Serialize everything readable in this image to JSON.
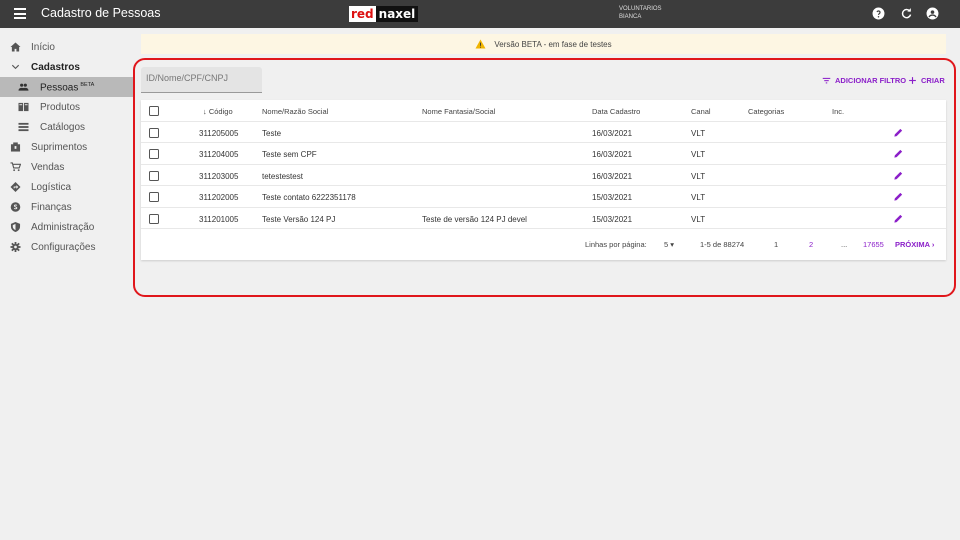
{
  "header": {
    "title": "Cadastro de Pessoas",
    "logo_red": "red",
    "logo_naxel": "naxel",
    "user_line1": "VOLUNTARIOS",
    "user_line2": "BIANCA",
    "icons": [
      "help-icon",
      "refresh-icon",
      "account-icon"
    ]
  },
  "sidebar": {
    "items": [
      {
        "label": "Início",
        "icon": "home-icon"
      },
      {
        "label": "Cadastros",
        "icon": "chevron-down-icon"
      },
      {
        "label": "Pessoas",
        "badge": "BETA",
        "icon": "people-icon"
      },
      {
        "label": "Produtos",
        "icon": "book-icon"
      },
      {
        "label": "Catálogos",
        "icon": "list-icon"
      },
      {
        "label": "Suprimentos",
        "icon": "box-icon"
      },
      {
        "label": "Vendas",
        "icon": "cart-icon"
      },
      {
        "label": "Logística",
        "icon": "direction-icon"
      },
      {
        "label": "Finanças",
        "icon": "money-icon"
      },
      {
        "label": "Administração",
        "icon": "shield-icon"
      },
      {
        "label": "Configurações",
        "icon": "gear-icon"
      }
    ]
  },
  "banner": {
    "text": "Versão BETA - em fase de testes"
  },
  "search": {
    "placeholder": "ID/Nome/CPF/CNPJ"
  },
  "toolbar": {
    "filter_label": "ADICIONAR FILTRO",
    "create_label": "CRIAR"
  },
  "table": {
    "columns": [
      "Código",
      "Nome/Razão Social",
      "Nome Fantasia/Social",
      "Data Cadastro",
      "Canal",
      "Categorias",
      "Inc."
    ],
    "sort_indicator": "↓",
    "rows": [
      {
        "codigo": "311205005",
        "nome": "Teste",
        "fantasia": "",
        "data": "16/03/2021",
        "canal": "VLT"
      },
      {
        "codigo": "311204005",
        "nome": "Teste sem CPF",
        "fantasia": "",
        "data": "16/03/2021",
        "canal": "VLT"
      },
      {
        "codigo": "311203005",
        "nome": "tetestestest",
        "fantasia": "",
        "data": "16/03/2021",
        "canal": "VLT"
      },
      {
        "codigo": "311202005",
        "nome": "Teste contato 6222351178",
        "fantasia": "",
        "data": "15/03/2021",
        "canal": "VLT"
      },
      {
        "codigo": "311201005",
        "nome": "Teste Versão 124 PJ",
        "fantasia": "Teste de versão 124 PJ devel",
        "data": "15/03/2021",
        "canal": "VLT"
      }
    ]
  },
  "pagination": {
    "rows_per_page_label": "Linhas por página:",
    "rows_per_page": "5",
    "range": "1-5 de 88274",
    "page_current": "1",
    "page_next": "2",
    "ellipsis": "...",
    "page_last": "17655",
    "next_label": "PRÓXIMA"
  },
  "colors": {
    "accent": "#8b1fc9",
    "topbar": "#3c3c3c",
    "annotation": "#e0161b"
  }
}
